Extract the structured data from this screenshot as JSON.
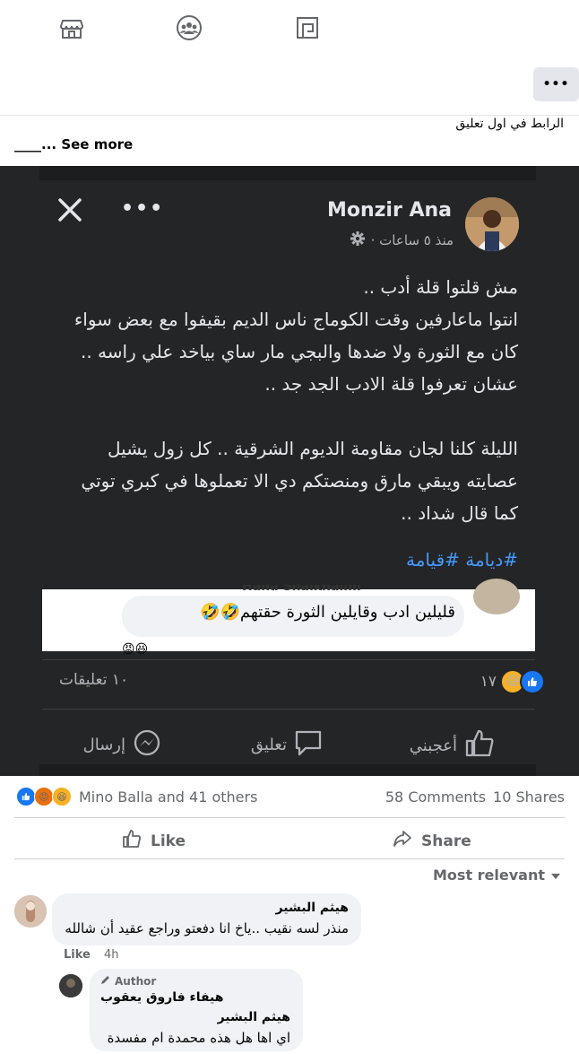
{
  "nav": {
    "icons": [
      "marketplace-icon",
      "groups-icon",
      "pages-icon"
    ]
  },
  "post": {
    "more_label": "•••",
    "caption": "الرابط في اول تعليق",
    "see_more": "____... See more"
  },
  "screenshot": {
    "author": "Monzir Ana",
    "time": "منذ ٥ ساعات ·",
    "body": "مش قلتوا قلة أدب ..\nانتوا ماعارفين وقت الكوماج ناس الديم بقيفوا مع بعض سواء كان مع الثورة ولا ضدها والبجي مار ساي بياخد علي راسه .. عشان تعرفوا قلة الادب الجد جد ..\n\nالليلة كلنا لجان مقاومة الديوم الشرقية .. كل زول يشيل عصايته ويبقي مارق ومنصتكم دي الا تعملوها في كبري توتي كما قال شداد ..",
    "hashtags": "#ديامة #قيامة",
    "embed_name": "Hana Shaikhalim",
    "embed_text": "قليلين ادب وقايلين الثورة حقتهم🤣🤣",
    "comments_count": "١٠ تعليقات",
    "likes_count": "١٧",
    "actions": {
      "like": "أعجبني",
      "comment": "تعليق",
      "send": "إرسال"
    }
  },
  "stats": {
    "reactors": "Mino Balla and 41 others",
    "comments": "58 Comments",
    "shares": "10 Shares"
  },
  "buttons": {
    "like": "Like",
    "share": "Share"
  },
  "sort": {
    "label": "Most relevant"
  },
  "comments": [
    {
      "name": "هيثم البشير",
      "text": "منذر لسه نقيب ..ياخ انا دفعتو وراجع عقيد أن شالله",
      "like": "Like",
      "time": "4h"
    }
  ],
  "reply": {
    "badge": "Author",
    "name": "هيفاء فاروق يعقوب",
    "mention": "هيثم البشير",
    "text": "اي اها هل هذه محمدة ام مفسدة"
  }
}
